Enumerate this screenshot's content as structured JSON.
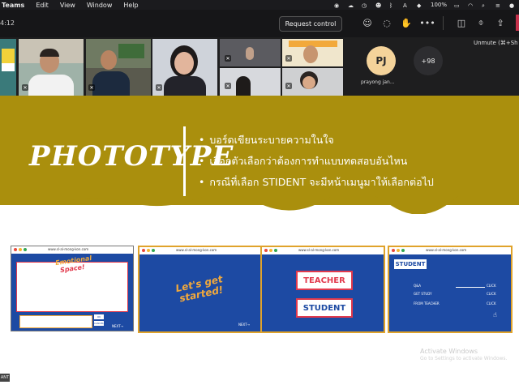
{
  "menubar": {
    "app": "Teams",
    "items": [
      "Edit",
      "View",
      "Window",
      "Help"
    ],
    "battery": "100%"
  },
  "toolbar": {
    "timer": "4:12",
    "request_control": "Request control"
  },
  "participants": {
    "avatar_initials": "PJ",
    "avatar_name": "prayong jan...",
    "more_count": "+98",
    "unmute_hint": "Unmute (⌘+Sh"
  },
  "slide": {
    "title": "PHOTOTYPE",
    "bullets": [
      "บอร์ดเขียนระบายความในใจ",
      "เลือกตัวเลือกว่าต้องการทำแบบทดสอบอันไหน",
      "กรณีที่เลือก STIDENT จะมีหน้าเมนูมาให้เลือกต่อไป"
    ],
    "thumb_url": "www.sl-al-mong-kon.com",
    "card1": {
      "heading1": "Emotional",
      "heading2": "Space!",
      "ok": "OK",
      "cancel": "CANCEL",
      "next": "NEXT→"
    },
    "card2": {
      "heading": "Let's get started!",
      "next": "NEXT→"
    },
    "card3": {
      "teacher": "TEACHER",
      "student": "STUDENT"
    },
    "card4": {
      "title": "STUDENT",
      "rows": [
        "Q&A",
        "GET STUDY",
        "FROM TEACHER"
      ],
      "click": "CLICK"
    }
  },
  "watermark": {
    "line1": "Activate Windows",
    "line2": "Go to Settings to activate Windows."
  },
  "corner_tag": "ANT"
}
